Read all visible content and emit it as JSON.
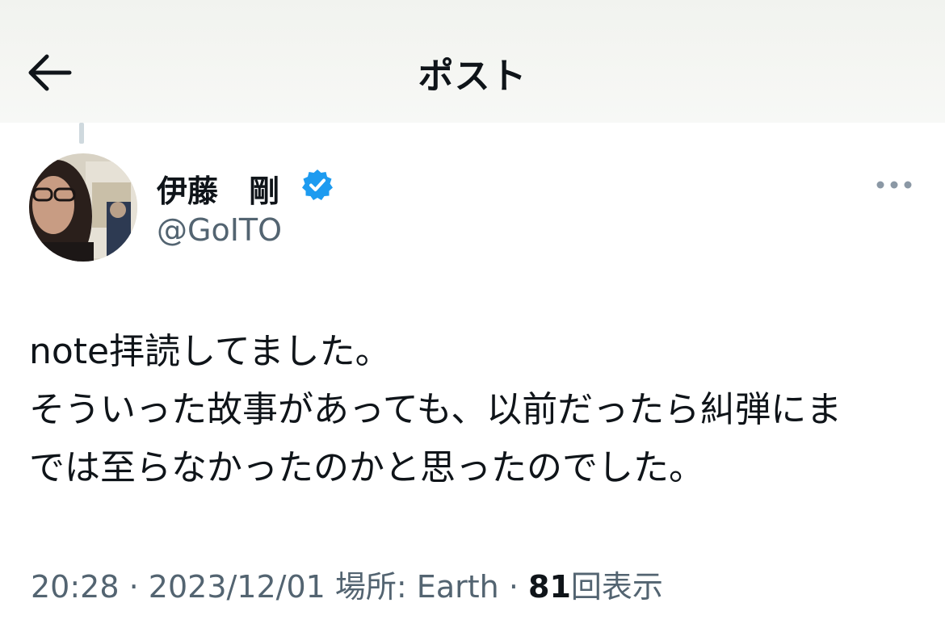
{
  "header": {
    "title": "ポスト",
    "back_icon": "arrow-left-icon"
  },
  "author": {
    "display_name": "伊藤　剛",
    "handle": "@GoITO",
    "verified_icon": "verified-badge-icon",
    "verified_color": "#1d9bf0"
  },
  "post": {
    "lines": [
      "note拝読してました。",
      "そういった故事があっても、以前だったら糾弾にま",
      "では至らなかったのかと思ったのでした。"
    ]
  },
  "meta": {
    "time": "20:28",
    "separator": "·",
    "date": "2023/12/01",
    "location_label": "場所: Earth",
    "views_count": "81",
    "views_label": "回表示"
  },
  "more_icon": "more-horizontal-icon"
}
